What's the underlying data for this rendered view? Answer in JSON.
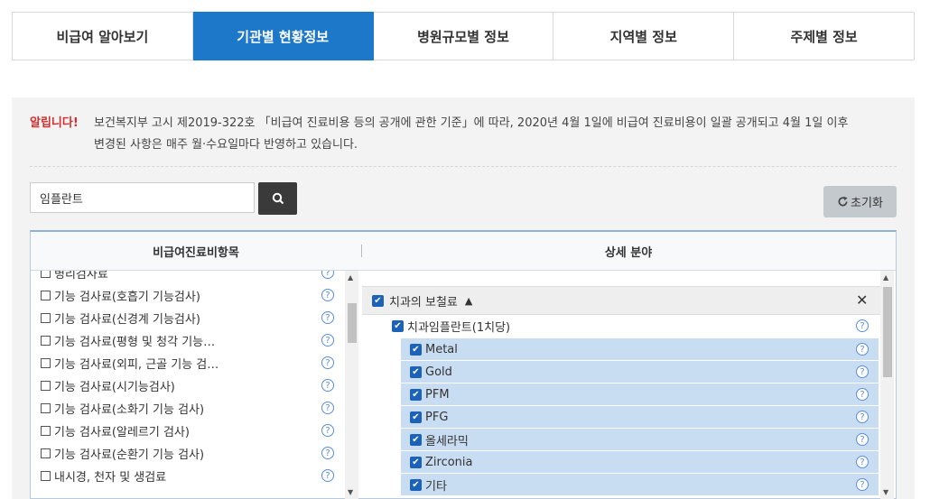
{
  "tabs": [
    "비급여 알아보기",
    "기관별 현황정보",
    "병원규모별 정보",
    "지역별 정보",
    "주제별 정보"
  ],
  "notice": {
    "label": "알립니다!",
    "line1": "보건복지부 고시 제2019-322호 「비급여 진료비용 등의 공개에 관한 기준」에 따라, 2020년 4월 1일에 비급여 진료비용이 일괄 공개되고 4월 1일 이후",
    "line2": "변경된 사항은 매주 월·수요일마다 반영하고 있습니다."
  },
  "search": {
    "value": "임플란트",
    "button_icon": "search-icon"
  },
  "reset_label": "초기화",
  "table": {
    "left_header": "비급여진료비항목",
    "right_header": "상세 분야",
    "left_items": [
      "병리검사료",
      "기능 검사료(호흡기 기능검사)",
      "기능 검사료(신경계 기능검사)",
      "기능 검사료(평형 및 청각 기능…",
      "기능 검사료(외피, 근골 기능 검…",
      "기능 검사료(시기능검사)",
      "기능 검사료(소화기 기능 검사)",
      "기능 검사료(알레르기 검사)",
      "기능 검사료(순환기 기능 검사)",
      "내시경, 천자 및 생검료"
    ],
    "group": "치과의 보철료",
    "subgroup": "치과임플란트(1치당)",
    "detail_items": [
      "Metal",
      "Gold",
      "PFM",
      "PFG",
      "올세라믹",
      "Zirconia",
      "기타"
    ]
  },
  "colors": {
    "accent": "#1d78c9",
    "alert": "#d32f2f",
    "selected_row": "#c8dcf2",
    "checkbox": "#1b62b8"
  }
}
